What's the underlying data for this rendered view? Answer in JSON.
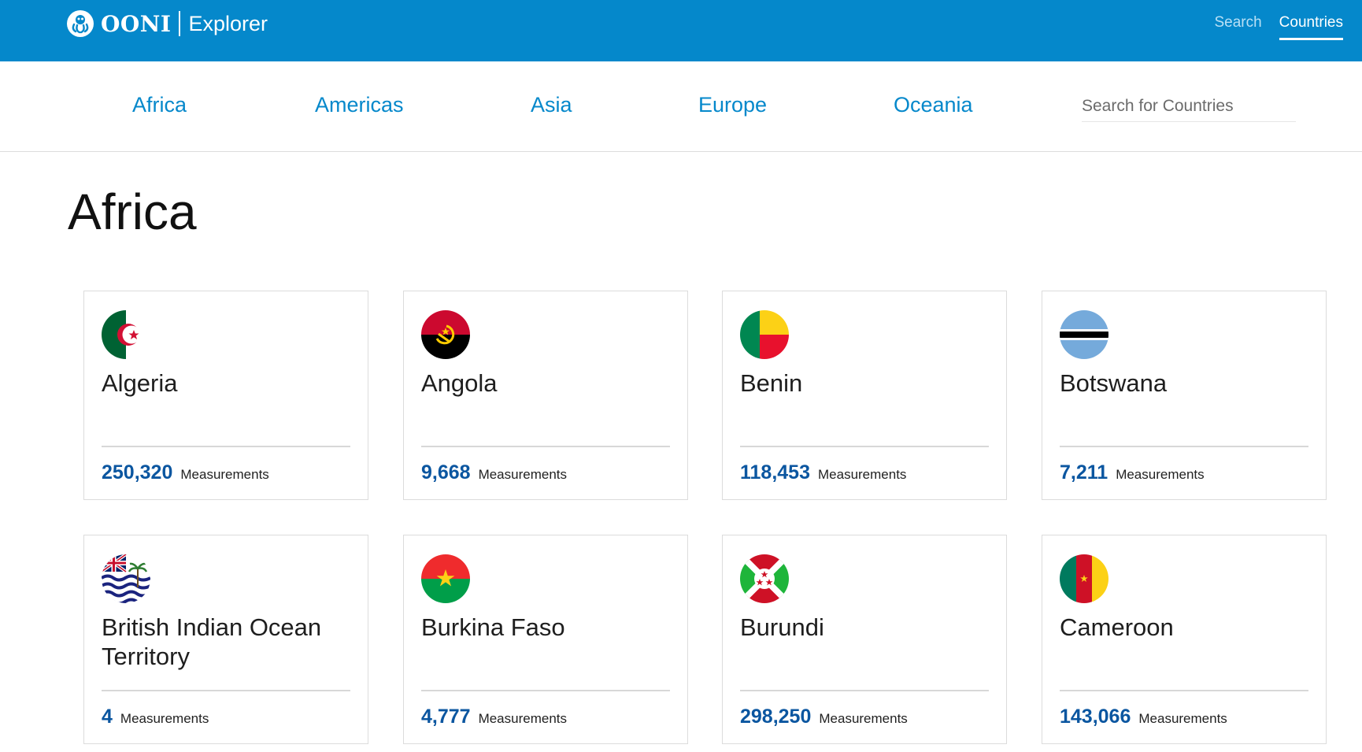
{
  "header": {
    "logo_icon": "ooni-octopus-icon",
    "brand_name": "OONI",
    "product_name": "Explorer",
    "nav": [
      {
        "label": "Search",
        "active": false
      },
      {
        "label": "Countries",
        "active": true
      }
    ],
    "bg_color": "#0588cb"
  },
  "region_tabs": [
    "Africa",
    "Americas",
    "Asia",
    "Europe",
    "Oceania"
  ],
  "search": {
    "placeholder": "Search for Countries",
    "value": ""
  },
  "region_heading": "Africa",
  "measurements_label": "Measurements",
  "countries": [
    {
      "name": "Algeria",
      "count": "250,320",
      "flag_icon": "algeria-flag-icon"
    },
    {
      "name": "Angola",
      "count": "9,668",
      "flag_icon": "angola-flag-icon"
    },
    {
      "name": "Benin",
      "count": "118,453",
      "flag_icon": "benin-flag-icon"
    },
    {
      "name": "Botswana",
      "count": "7,211",
      "flag_icon": "botswana-flag-icon"
    },
    {
      "name": "British Indian Ocean Territory",
      "count": "4",
      "flag_icon": "british-indian-ocean-territory-flag-icon"
    },
    {
      "name": "Burkina Faso",
      "count": "4,777",
      "flag_icon": "burkina-faso-flag-icon"
    },
    {
      "name": "Burundi",
      "count": "298,250",
      "flag_icon": "burundi-flag-icon"
    },
    {
      "name": "Cameroon",
      "count": "143,066",
      "flag_icon": "cameroon-flag-icon"
    }
  ],
  "colors": {
    "accent": "#0588cb",
    "count_text": "#0b56a0"
  }
}
